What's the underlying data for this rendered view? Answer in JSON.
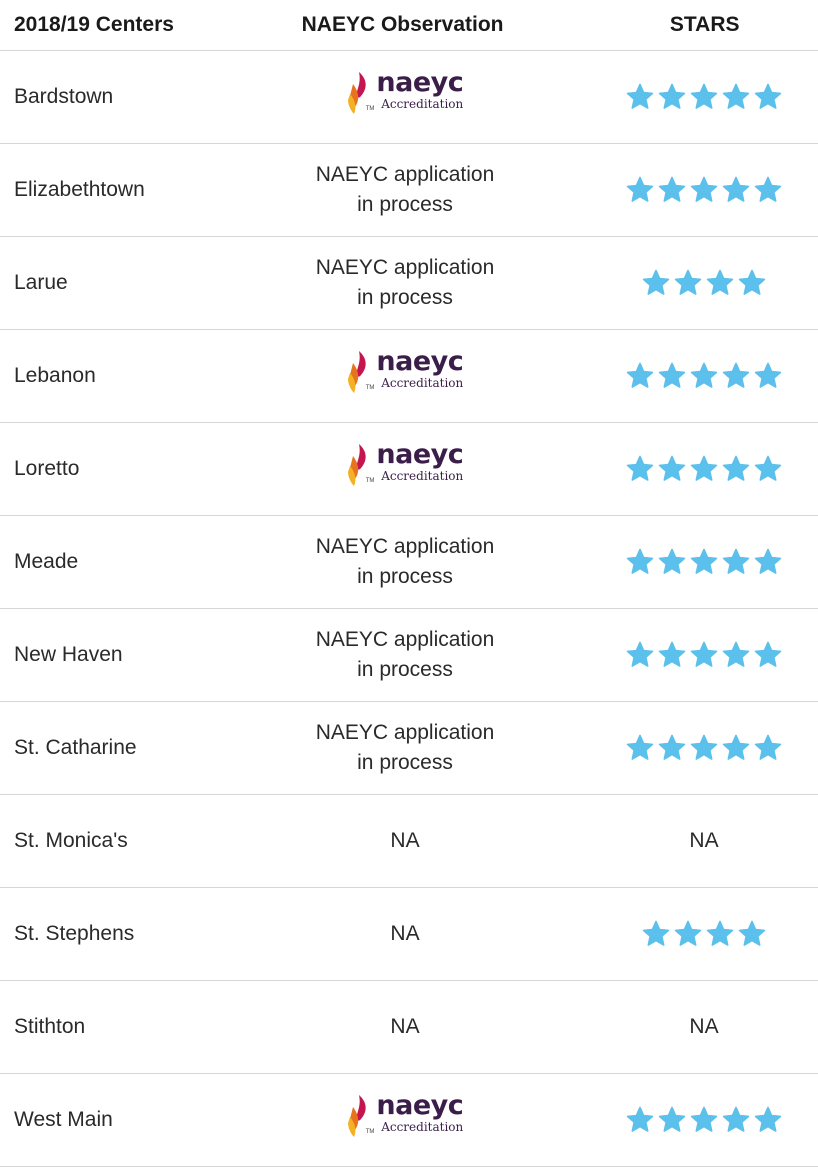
{
  "colors": {
    "star": "#5bc0eb",
    "divider": "#d6d6d6"
  },
  "header": {
    "centers": "2018/19 Centers",
    "observation": "NAEYC Observation",
    "stars": "STARS"
  },
  "logo": {
    "main": "naeyc",
    "sub": "Accreditation",
    "tm": "TM",
    "icon": "naeyc-flame-icon"
  },
  "rows": [
    {
      "center": "Bardstown",
      "observation": {
        "type": "logo"
      },
      "stars": 5
    },
    {
      "center": "Elizabethtown",
      "observation": {
        "type": "text",
        "text": "NAEYC application\nin process"
      },
      "stars": 5
    },
    {
      "center": "Larue",
      "observation": {
        "type": "text",
        "text": "NAEYC application\nin process"
      },
      "stars": 4
    },
    {
      "center": "Lebanon",
      "observation": {
        "type": "logo"
      },
      "stars": 5
    },
    {
      "center": "Loretto",
      "observation": {
        "type": "logo"
      },
      "stars": 5
    },
    {
      "center": "Meade",
      "observation": {
        "type": "text",
        "text": "NAEYC application\nin process"
      },
      "stars": 5
    },
    {
      "center": "New Haven",
      "observation": {
        "type": "text",
        "text": "NAEYC application\nin process"
      },
      "stars": 5
    },
    {
      "center": "St. Catharine",
      "observation": {
        "type": "text",
        "text": "NAEYC application\nin process"
      },
      "stars": 5
    },
    {
      "center": "St. Monica's",
      "observation": {
        "type": "text",
        "text": "NA"
      },
      "stars": null,
      "stars_text": "NA"
    },
    {
      "center": "St. Stephens",
      "observation": {
        "type": "text",
        "text": "NA"
      },
      "stars": 4
    },
    {
      "center": "Stithton",
      "observation": {
        "type": "text",
        "text": "NA"
      },
      "stars": null,
      "stars_text": "NA"
    },
    {
      "center": "West Main",
      "observation": {
        "type": "logo"
      },
      "stars": 5
    }
  ]
}
